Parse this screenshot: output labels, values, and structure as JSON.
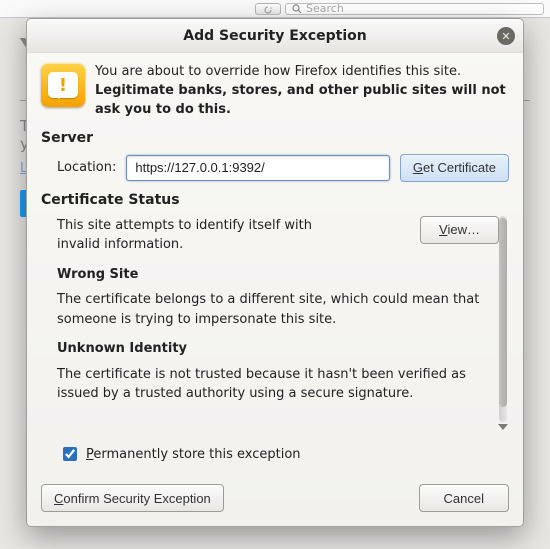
{
  "backdrop": {
    "reload_tooltip": "Reload",
    "search_placeholder": "Search",
    "heading_fragment": "Y",
    "line1_fragment": "T",
    "line2_fragment": "y",
    "link_fragment": "L"
  },
  "dialog": {
    "title": "Add Security Exception",
    "close_glyph": "✕",
    "warning_line1": "You are about to override how Firefox identifies this site.",
    "warning_line2": "Legitimate banks, stores, and other public sites will not ask you to do this.",
    "server_heading": "Server",
    "location_label": "Location:",
    "location_value": "https://127.0.0.1:9392/",
    "get_cert_html": "<span class=\"u\">G</span>et Certificate",
    "status_heading": "Certificate Status",
    "status_intro": "This site attempts to identify itself with invalid information.",
    "view_html": "<span class=\"u\">V</span>iew…",
    "wrong_site_heading": "Wrong Site",
    "wrong_site_body": "The certificate belongs to a different site, which could mean that someone is trying to impersonate this site.",
    "unknown_heading": "Unknown Identity",
    "unknown_body": "The certificate is not trusted because it hasn't been verified as issued by a trusted authority using a secure signature.",
    "perm_html": "<span class=\"u\">P</span>ermanently store this exception",
    "perm_checked": true,
    "confirm_html": "<span class=\"u\">C</span>onfirm Security Exception",
    "cancel_label": "Cancel"
  }
}
